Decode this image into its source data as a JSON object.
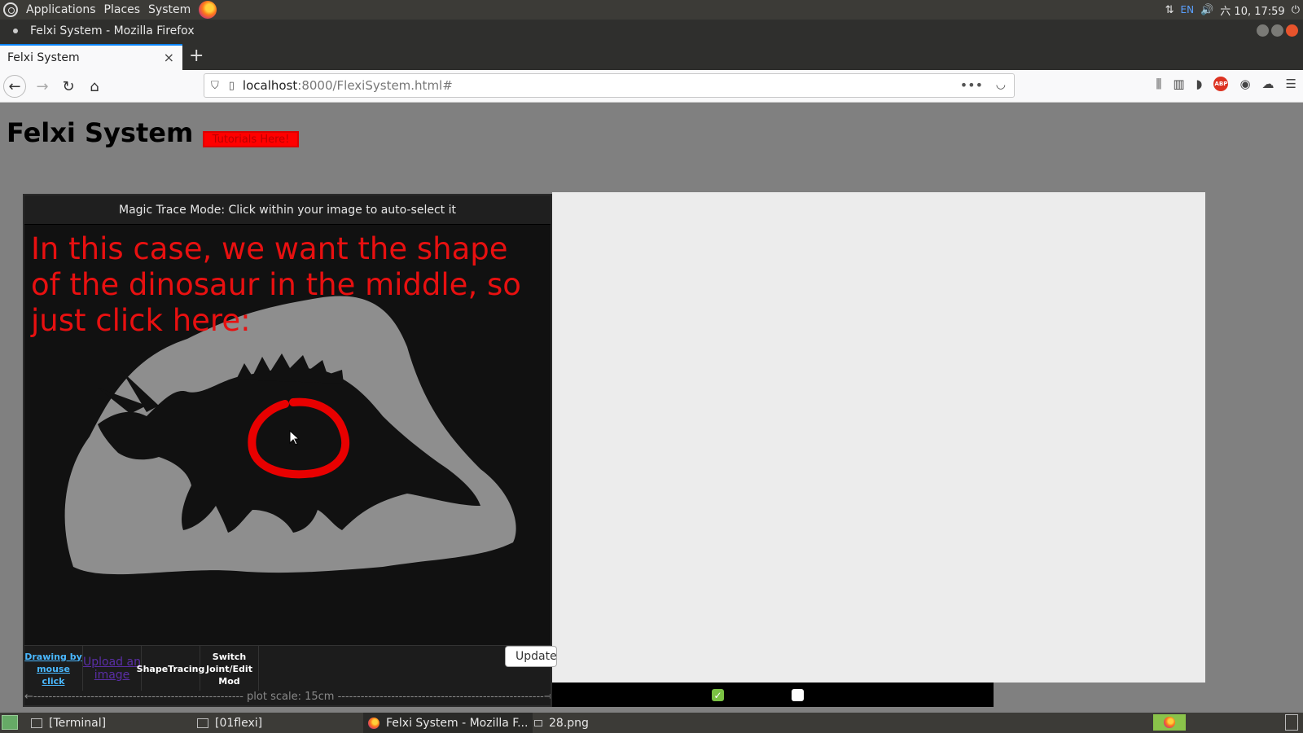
{
  "os_panel": {
    "menus": [
      "Applications",
      "Places",
      "System"
    ],
    "lang": "EN",
    "clock": "六 10, 17:59"
  },
  "window": {
    "title": "Felxi System - Mozilla Firefox"
  },
  "browser": {
    "tab_title": "Felxi System",
    "tab_close": "×",
    "new_tab": "+",
    "url_host": "localhost",
    "url_rest": ":8000/FlexiSystem.html#",
    "dots": "•••",
    "abp_label": "ABP"
  },
  "page": {
    "title": "Felxi System",
    "tutorial_button": "Tutorials Here!",
    "mode_header": "Magic Trace Mode: Click within your image to auto-select it",
    "annotation": "In this case, we want the shape of the dinosaur in the middle, so just click here:",
    "tools": {
      "drawing": "Drawing by mouse click",
      "upload": "Upload an image",
      "shape": "ShapeTracing",
      "switch": "Switch Joint/Edit Mod"
    },
    "update_button": "Update",
    "plot_scale": "←------------------------------------------------------- plot scale: 15cm ------------------------------------------------------→",
    "checkbox_1_checked": true,
    "checkbox_2_checked": false
  },
  "taskbar": {
    "items": [
      "[Terminal]",
      "[01flexi]",
      "Felxi System - Mozilla F...",
      "28.png"
    ]
  }
}
